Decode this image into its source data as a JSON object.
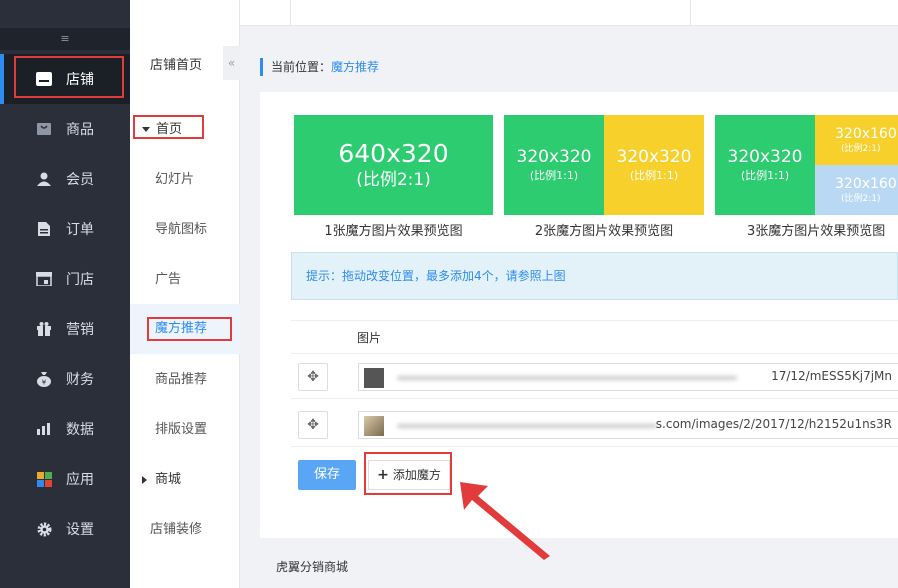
{
  "sidebar": {
    "items": [
      {
        "label": "店铺",
        "icon": "store-icon"
      },
      {
        "label": "商品",
        "icon": "goods-icon"
      },
      {
        "label": "会员",
        "icon": "member-icon"
      },
      {
        "label": "订单",
        "icon": "order-icon"
      },
      {
        "label": "门店",
        "icon": "shop-icon"
      },
      {
        "label": "营销",
        "icon": "gift-icon"
      },
      {
        "label": "财务",
        "icon": "money-bag-icon"
      },
      {
        "label": "数据",
        "icon": "bar-chart-icon"
      },
      {
        "label": "应用",
        "icon": "apps-icon"
      },
      {
        "label": "设置",
        "icon": "gear-icon"
      }
    ],
    "active_index": 0
  },
  "subnav": {
    "title": "店铺首页",
    "section_home": "首页",
    "items": [
      "幻灯片",
      "导航图标",
      "广告",
      "魔方推荐",
      "商品推荐",
      "排版设置"
    ],
    "active": "魔方推荐",
    "section_mall": "商城",
    "decor": "店铺装修",
    "collapse_glyph": "«"
  },
  "breadcrumb": {
    "prefix": "当前位置：",
    "current": "魔方推荐"
  },
  "previews": {
    "one": {
      "size": "640x320",
      "ratio": "(比例2:1)",
      "caption": "1张魔方图片效果预览图"
    },
    "two": {
      "left_size": "320x320",
      "left_ratio": "(比例1:1)",
      "right_size": "320x320",
      "right_ratio": "(比例1:1)",
      "caption": "2张魔方图片效果预览图"
    },
    "three": {
      "left_size": "320x320",
      "left_ratio": "(比例1:1)",
      "tr_size": "320x160",
      "tr_ratio": "(比例2:1)",
      "br_size": "320x160",
      "br_ratio": "(比例2:1)",
      "caption": "3张魔方图片效果预览图"
    }
  },
  "tip": "提示：拖动改变位置，最多添加4个，请参照上图",
  "table": {
    "header": "图片",
    "rows": [
      {
        "url_tail": "17/12/mESS5Kj7jMn"
      },
      {
        "url_tail": "s.com/images/2/2017/12/h2152u1ns3R"
      }
    ]
  },
  "buttons": {
    "save": "保存",
    "add_plus": "+",
    "add": "添加魔方"
  },
  "footer": "虎翼分销商城",
  "colors": {
    "green": "#2ecc71",
    "yellow": "#f7d02c",
    "light_blue": "#b9d8f3",
    "accent": "#2d8cf0",
    "annotation": "#e23b3b"
  }
}
